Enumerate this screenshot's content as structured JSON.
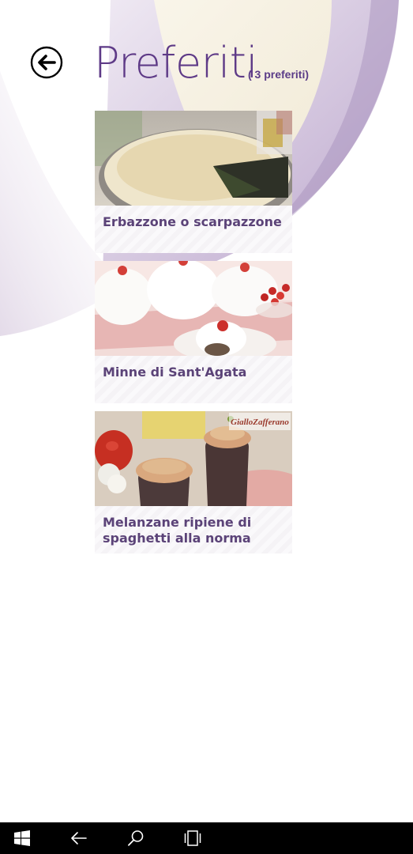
{
  "header": {
    "title": "Preferiti",
    "count_label": "( 3 preferiti)"
  },
  "favorites": [
    {
      "title": "Erbazzone o scarpazzone"
    },
    {
      "title": "Minne di Sant'Agata"
    },
    {
      "title": "Melanzane ripiene di spaghetti alla norma",
      "watermark": "GialloZafferano"
    }
  ],
  "colors": {
    "accent": "#5e3a87",
    "card_title": "#5b4378",
    "taskbar": "#000000"
  },
  "icons": {
    "back": "back-arrow-circle-icon",
    "taskbar": [
      "windows-start-icon",
      "back-arrow-icon",
      "search-icon",
      "task-view-icon"
    ]
  }
}
